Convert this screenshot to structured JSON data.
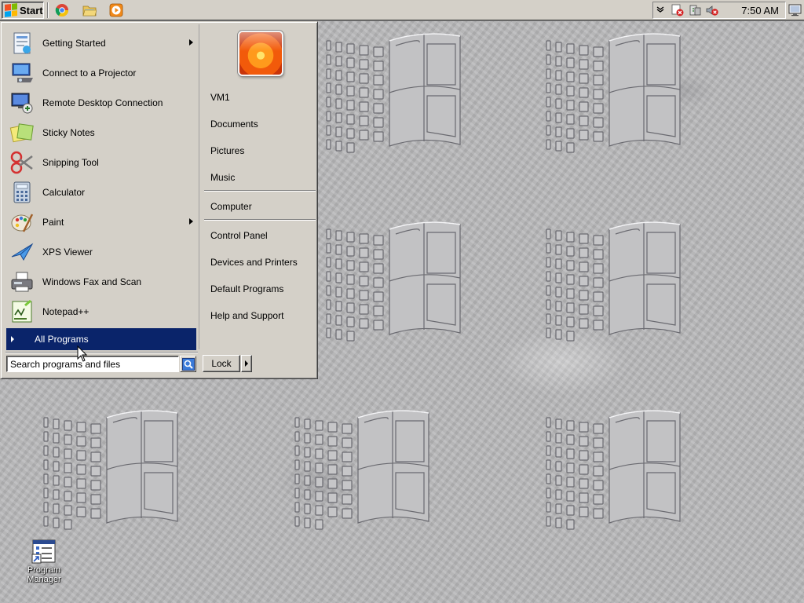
{
  "taskbar": {
    "start_label": "Start",
    "quick_launch": [
      {
        "icon": "chrome-icon"
      },
      {
        "icon": "folder-icon"
      },
      {
        "icon": "media-player-icon"
      }
    ],
    "tray": {
      "chevron_icon": "chevron-down-icon",
      "icons": [
        "network-error-icon",
        "power-icon",
        "volume-muted-icon"
      ],
      "clock": "7:50 AM"
    }
  },
  "start_menu": {
    "programs": [
      {
        "label": "Getting Started",
        "icon": "getting-started-icon",
        "has_submenu": true
      },
      {
        "label": "Connect to a Projector",
        "icon": "projector-icon",
        "has_submenu": false
      },
      {
        "label": "Remote Desktop Connection",
        "icon": "remote-desktop-icon",
        "has_submenu": false
      },
      {
        "label": "Sticky Notes",
        "icon": "sticky-notes-icon",
        "has_submenu": false
      },
      {
        "label": "Snipping Tool",
        "icon": "snipping-tool-icon",
        "has_submenu": false
      },
      {
        "label": "Calculator",
        "icon": "calculator-icon",
        "has_submenu": false
      },
      {
        "label": "Paint",
        "icon": "paint-icon",
        "has_submenu": true
      },
      {
        "label": "XPS Viewer",
        "icon": "xps-viewer-icon",
        "has_submenu": false
      },
      {
        "label": "Windows Fax and Scan",
        "icon": "fax-scan-icon",
        "has_submenu": false
      },
      {
        "label": "Notepad++",
        "icon": "notepad-plus-plus-icon",
        "has_submenu": false
      }
    ],
    "all_programs_label": "All Programs",
    "search": {
      "placeholder": "Search programs and files",
      "value": ""
    },
    "user_name": "VM1",
    "places_group1": [
      "Documents",
      "Pictures",
      "Music"
    ],
    "places_group2": [
      "Computer"
    ],
    "places_group3": [
      "Control Panel",
      "Devices and Printers",
      "Default Programs",
      "Help and Support"
    ],
    "lock_label": "Lock"
  },
  "desktop": {
    "icons": [
      {
        "label": "Program Manager",
        "icon": "program-manager-icon"
      }
    ]
  },
  "colors": {
    "menu_bg": "#d4d0c8",
    "highlight": "#0a246a",
    "desktop_bg": "#b9b9bb"
  }
}
